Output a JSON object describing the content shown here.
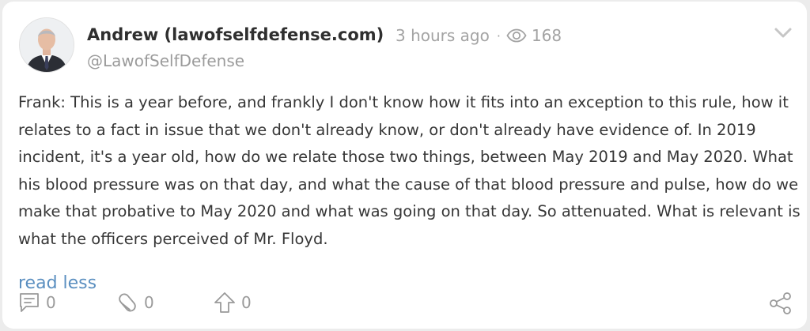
{
  "post": {
    "author_name": "Andrew (lawofselfdefense.com)",
    "handle": "@LawofSelfDefense",
    "time_ago": "3 hours ago",
    "separator": "·",
    "views": "168",
    "body": "Frank: This is a year before, and frankly I don't know how it fits into an exception to this rule, how it relates to a fact in issue that we don't already know, or don't already have evidence of. In 2019 incident, it's a year old, how do we relate those two things, between May 2019 and May 2020. What his blood pressure was on that day, and what the cause of that blood pressure and pulse, how do we make that probative to May 2020 and what was going on that day. So attenuated. What is relevant is what the officers perceived of Mr. Floyd.",
    "read_less_label": "read less"
  },
  "actions": {
    "comments": "0",
    "reposts": "0",
    "upvotes": "0"
  },
  "icons": {
    "views": "eye-icon",
    "menu": "chevron-down-icon",
    "comments": "comment-icon",
    "reposts": "repost-icon",
    "upvotes": "upvote-icon",
    "share": "share-icon"
  },
  "colors": {
    "link": "#5b8fc0",
    "muted": "#a3a3a3",
    "text": "#363636",
    "background": "#ececec"
  }
}
